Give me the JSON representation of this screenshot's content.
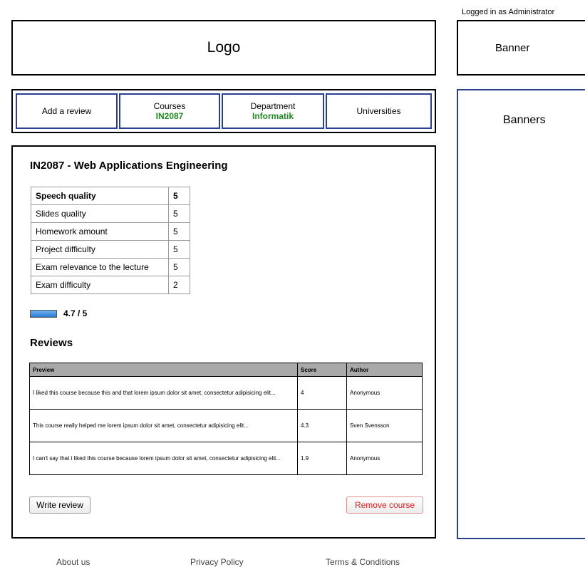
{
  "header": {
    "login_status": "Logged in as Administrator",
    "logo_label": "Logo",
    "banner_label": "Banner"
  },
  "nav": {
    "items": [
      {
        "label": "Add a review",
        "sub": ""
      },
      {
        "label": "Courses",
        "sub": "IN2087"
      },
      {
        "label": "Department",
        "sub": "Informatik"
      },
      {
        "label": "Universities",
        "sub": ""
      }
    ]
  },
  "sidebar": {
    "banners_label": "Banners"
  },
  "course": {
    "title": "IN2087 - Web Applications Engineering",
    "ratings": [
      {
        "label": "Speech quality",
        "value": "5"
      },
      {
        "label": "Slides quality",
        "value": "5"
      },
      {
        "label": "Homework amount",
        "value": "5"
      },
      {
        "label": "Project difficulty",
        "value": "5"
      },
      {
        "label": "Exam relevance to the lecture",
        "value": "5"
      },
      {
        "label": "Exam difficulty",
        "value": "2"
      }
    ],
    "overall_score_text": "4.7 / 5",
    "overall_score_fraction": 0.94
  },
  "reviews": {
    "title": "Reviews",
    "columns": [
      "Preview",
      "Score",
      "Author"
    ],
    "rows": [
      {
        "preview": "I liked this course because this and that lorem ipsum dolor sit amet, consectetur adipisicing elit...",
        "score": "4",
        "author": "Anonymous"
      },
      {
        "preview": "This course really helped me lorem ipsum dolor sit amet, consectetur adipisicing elit...",
        "score": "4.3",
        "author": "Sven Svensson"
      },
      {
        "preview": "I can't say that i liked this course because lorem ipsum dolor sit amet, consectetur adipisicing elit...",
        "score": "1.9",
        "author": "Anonymous"
      }
    ]
  },
  "actions": {
    "write_review": "Write review",
    "remove_course": "Remove course"
  },
  "footer": {
    "links": [
      "About us",
      "Privacy Policy",
      "Terms & Conditions"
    ]
  },
  "colors": {
    "nav_border": "#2a3f8f",
    "nav_sub_text": "#1e8a1e",
    "remove_text": "#e01c1c",
    "score_bar": "#2b7ad6"
  }
}
